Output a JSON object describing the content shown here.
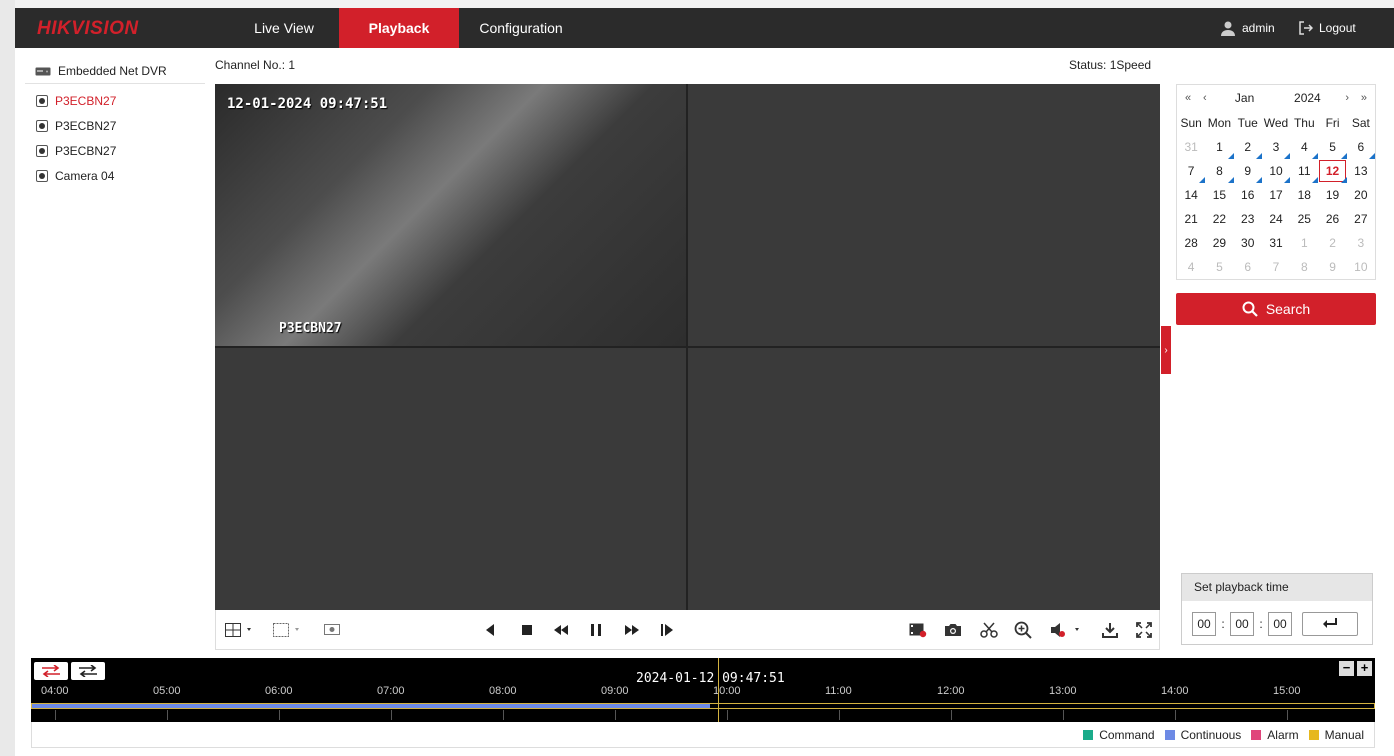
{
  "brand": "HIKVISION",
  "nav": {
    "tabs": [
      {
        "label": "Live View"
      },
      {
        "label": "Playback"
      },
      {
        "label": "Configuration"
      }
    ]
  },
  "user": {
    "name": "admin",
    "logout": "Logout"
  },
  "sidebar": {
    "device": "Embedded Net DVR",
    "cameras": [
      {
        "label": "P3ECBN27",
        "active": true
      },
      {
        "label": "P3ECBN27"
      },
      {
        "label": "P3ECBN27"
      },
      {
        "label": "Camera 04"
      }
    ]
  },
  "player": {
    "channel": "Channel No.: 1",
    "status": "Status: 1Speed",
    "osd_time": "12-01-2024 09:47:51",
    "osd_name": "P3ECBN27"
  },
  "calendar": {
    "month": "Jan",
    "year": "2024",
    "weekdays": [
      "Sun",
      "Mon",
      "Tue",
      "Wed",
      "Thu",
      "Fri",
      "Sat"
    ],
    "weeks": [
      [
        "31",
        "1",
        "2",
        "3",
        "4",
        "5",
        "6"
      ],
      [
        "7",
        "8",
        "9",
        "10",
        "11",
        "12",
        "13"
      ],
      [
        "14",
        "15",
        "16",
        "17",
        "18",
        "19",
        "20"
      ],
      [
        "21",
        "22",
        "23",
        "24",
        "25",
        "26",
        "27"
      ],
      [
        "28",
        "29",
        "30",
        "31",
        "1",
        "2",
        "3"
      ],
      [
        "4",
        "5",
        "6",
        "7",
        "8",
        "9",
        "10"
      ]
    ],
    "selected": "12",
    "record_days": [
      "1",
      "2",
      "3",
      "4",
      "5",
      "6",
      "7",
      "8",
      "9",
      "10",
      "11",
      "12"
    ]
  },
  "search": {
    "label": "Search"
  },
  "playback_time": {
    "title": "Set playback time",
    "hh": "00",
    "mm": "00",
    "ss": "00"
  },
  "timeline": {
    "current": "2024-01-12 09:47:51",
    "ticks": [
      "04:00",
      "05:00",
      "06:00",
      "07:00",
      "08:00",
      "09:00",
      "10:00",
      "11:00",
      "12:00",
      "13:00",
      "14:00",
      "15:00"
    ],
    "recording_start": "04:00",
    "recording_end": "09:51"
  },
  "legend": [
    {
      "label": "Command",
      "color": "#1aab8a"
    },
    {
      "label": "Continuous",
      "color": "#6d8ae5"
    },
    {
      "label": "Alarm",
      "color": "#e0457b"
    },
    {
      "label": "Manual",
      "color": "#e6b81e"
    }
  ],
  "colors": {
    "accent": "#d2202a",
    "header": "#2b2b2b",
    "selection": "#d4b340"
  }
}
